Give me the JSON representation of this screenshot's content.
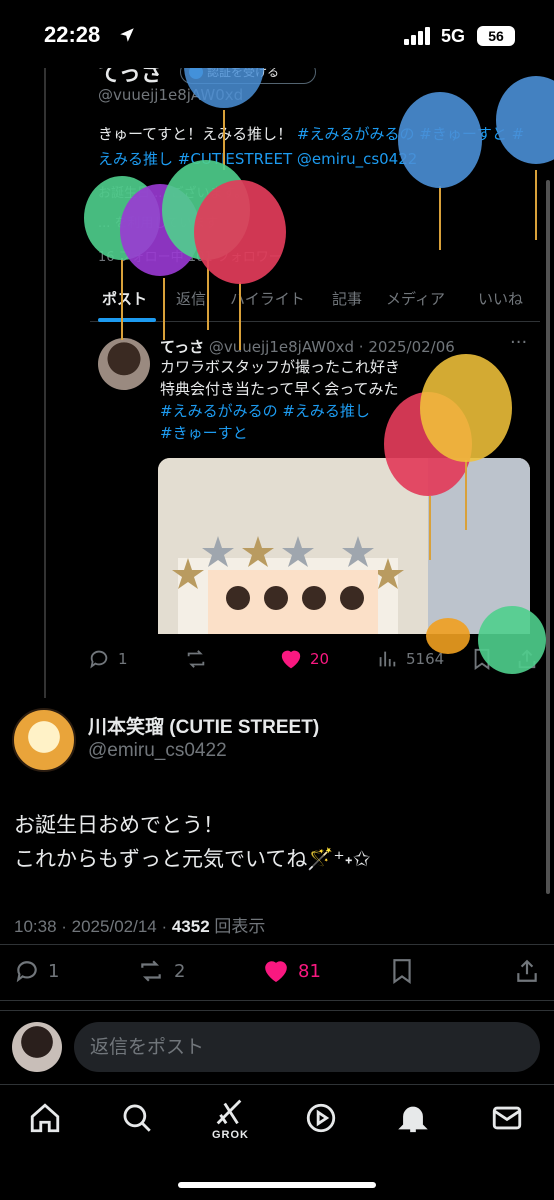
{
  "status_bar": {
    "time": "22:28",
    "network": "5G",
    "battery": "56"
  },
  "quoted_profile": {
    "name_partial": "てっさ",
    "verify_button": "認証を受ける",
    "handle": "@vuuejj1e8jAW0xd",
    "bio_text": "きゅーてすと！えみる推し！",
    "bio_tags": [
      "#えみるがみるの",
      "#きゅーすと",
      "#えみる推し",
      "#CUTIESTREET",
      "@emiru_cs0422"
    ],
    "meta_line_1": "お誕生日 ... ございます。",
    "meta_line_2": "... を利用しています",
    "follow_line": "16 フォロー中  101 フォロワー",
    "tabs": [
      "ポスト",
      "返信",
      "ハイライト",
      "記事",
      "メディア",
      "いいね"
    ]
  },
  "inner_post": {
    "name": "てっさ",
    "handle_date": "@vuuejj1e8jAW0xd · 2025/02/06",
    "line1": "カワラボスタッフが撮ったこれ好き",
    "line2": "特典会付き当たって早く会ってみた",
    "tags_line1": "#えみるがみるの #えみる推し",
    "tags_line2": "#きゅーすと"
  },
  "quoted_actions": {
    "replies": "1",
    "likes": "20",
    "views": "5164"
  },
  "main_post": {
    "author_name": "川本笑瑠 (CUTIE STREET)",
    "author_handle": "@emiru_cs0422",
    "text_line1": "お誕生日おめでとう！",
    "text_line2": "これからもずっと元気でいてね🪄⁺˖✩",
    "timestamp": "10:38 · 2025/02/14 · ",
    "views_count": "4352",
    "views_label": " 回表示",
    "replies": "1",
    "reposts": "2",
    "likes": "81"
  },
  "reply": {
    "placeholder": "返信をポスト"
  },
  "bottom_nav": {
    "grok_label": "GROK"
  },
  "colors": {
    "accent": "#1d9bf0",
    "like": "#f91880",
    "background": "#000000"
  }
}
